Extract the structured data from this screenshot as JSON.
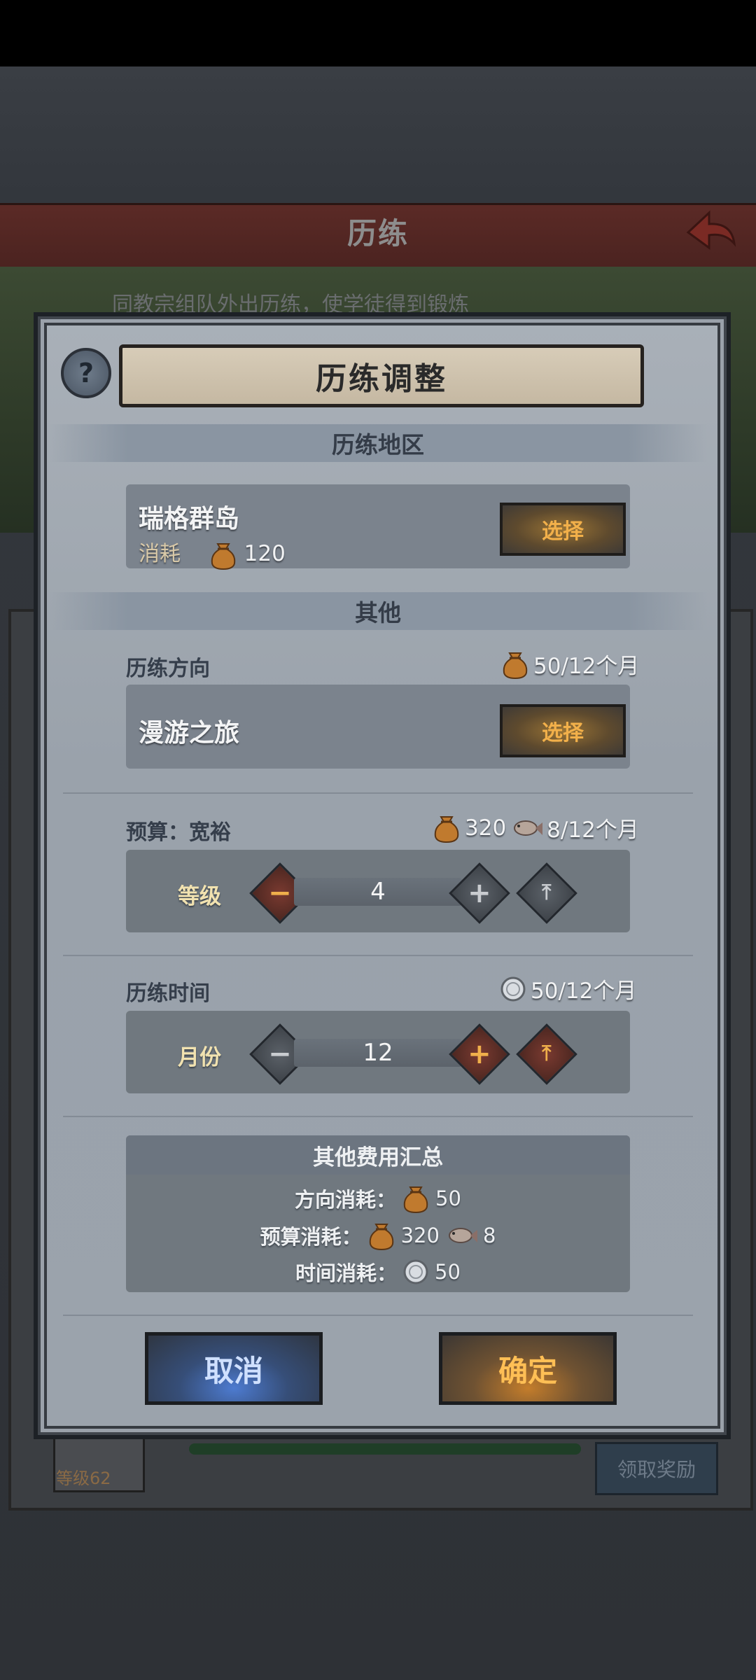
{
  "background": {
    "title": "历练",
    "subtitle": "同教宗组队外出历练，使学徒得到锻炼",
    "level_label": "等级62",
    "claim_button": "领取奖励"
  },
  "dialog": {
    "title": "历练调整",
    "help_icon": "question-icon",
    "region_section": "历练地区",
    "region": {
      "name": "瑞格群岛",
      "cost_label": "消耗",
      "cost_value": "120",
      "select_label": "选择"
    },
    "other_section": "其他",
    "direction": {
      "label": "历练方向",
      "cost": "50/12个月",
      "name": "漫游之旅",
      "select_label": "选择"
    },
    "budget": {
      "label": "预算：宽裕",
      "cost_bags": "320",
      "cost_fish": "8/12个月",
      "stepper_label": "等级",
      "value": "4"
    },
    "time": {
      "label": "历练时间",
      "cost": "50/12个月",
      "stepper_label": "月份",
      "value": "12"
    },
    "summary": {
      "title": "其他费用汇总",
      "direction_key": "方向消耗：",
      "direction_value": "50",
      "budget_key": "预算消耗：",
      "budget_bags": "320",
      "budget_fish": "8",
      "time_key": "时间消耗：",
      "time_value": "50"
    },
    "cancel_label": "取消",
    "confirm_label": "确定"
  },
  "colors": {
    "accent_orange": "#f2b04a",
    "cancel_blue": "#4d7bd0",
    "dialog_bg": "#9ba3ac"
  }
}
